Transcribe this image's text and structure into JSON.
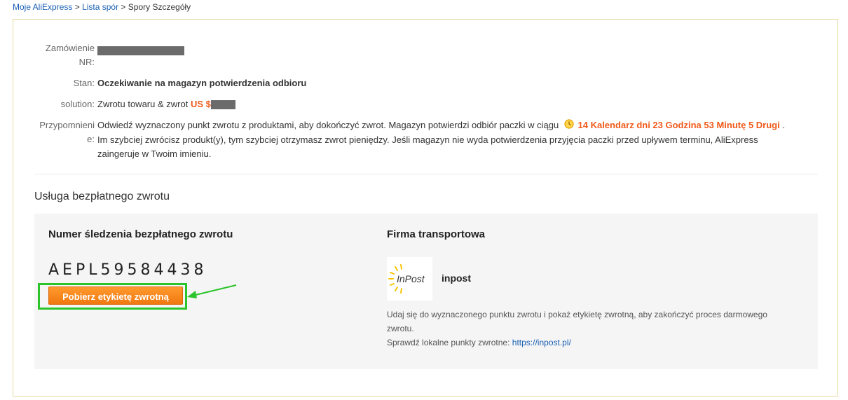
{
  "breadcrumb": {
    "link1": "Moje AliExpress",
    "sep1": " > ",
    "link2": "Lista spór",
    "sep2": " > ",
    "current": "Spory Szczegóły"
  },
  "order": {
    "label_line1": "Zamówienie",
    "label_line2": "NR:"
  },
  "status": {
    "label": "Stan:",
    "value": "Oczekiwanie na magazyn potwierdzenia odbioru"
  },
  "solution": {
    "label": "solution:",
    "text": "Zwrotu towaru & zwrot",
    "amount_prefix": "US $"
  },
  "reminder": {
    "label_line1": "Przypomnieni",
    "label_line2": "e:",
    "text_part1": "Odwiedź wyznaczony punkt zwrotu z produktami, aby dokończyć zwrot. Magazyn potwierdzi odbiór paczki w ciągu",
    "countdown": "14 Kalendarz dni 23 Godzina 53 Minutę 5 Drugi",
    "text_part2": ".",
    "line2": "Im szybciej zwrócisz produkt(y), tym szybciej otrzymasz zwrot pieniędzy. Jeśli magazyn nie wyda potwierdzenia przyjęcia paczki przed upływem terminu, AliExpress",
    "line3": "zaingeruje w Twoim imieniu."
  },
  "free_return": {
    "section_title": "Usługa bezpłatnego zwrotu",
    "tracking_title": "Numer śledzenia bezpłatnego zwrotu",
    "tracking_number": "AEPL59584438",
    "download_button": "Pobierz etykietę zwrotną",
    "carrier_title": "Firma transportowa",
    "carrier_logo_text": "InPost",
    "carrier_name": "inpost",
    "info_line1": "Udaj się do wyznaczonego punktu zwrotu i pokaż etykietę zwrotną, aby zakończyć proces darmowego",
    "info_line2": "zwrotu.",
    "info_line3_prefix": "Sprawdź lokalne punkty zwrotne:",
    "info_link": "https://inpost.pl/"
  },
  "colors": {
    "accent_orange": "#f05a1a",
    "status_green": "#2e8b00",
    "highlight_green": "#2bc42a",
    "link_blue": "#1a5fb4"
  }
}
